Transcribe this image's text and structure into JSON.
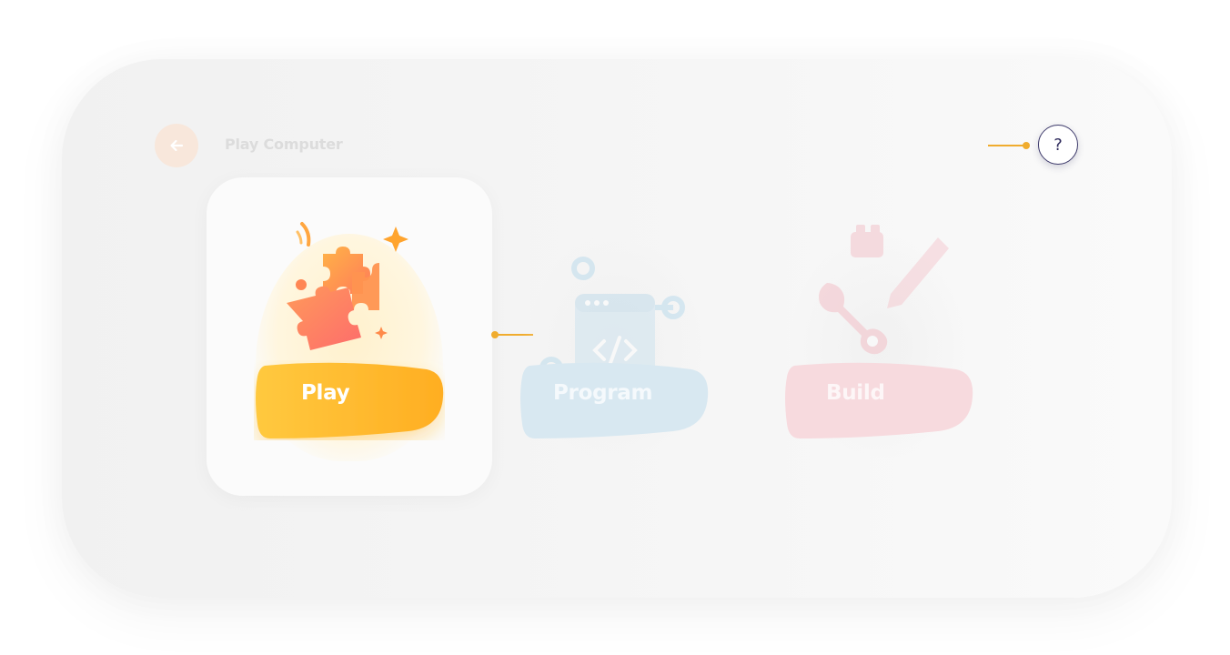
{
  "header": {
    "title": "Play Computer",
    "back_icon": "arrow-left-icon",
    "help_label": "?",
    "help_icon": "question-mark-icon"
  },
  "modes": [
    {
      "label": "Play",
      "icon": "puzzle-icon",
      "state": "selected",
      "color": "#fdb42b"
    },
    {
      "label": "Program",
      "icon": "code-window-icon",
      "state": "dimmed",
      "color": "#d6e6ef"
    },
    {
      "label": "Build",
      "icon": "wrench-pencil-icon",
      "state": "dimmed",
      "color": "#f6d7dc"
    }
  ],
  "colors": {
    "accent": "#f0ac2e",
    "help_border": "#3d3a6b",
    "back_bg": "#f8e7db"
  }
}
